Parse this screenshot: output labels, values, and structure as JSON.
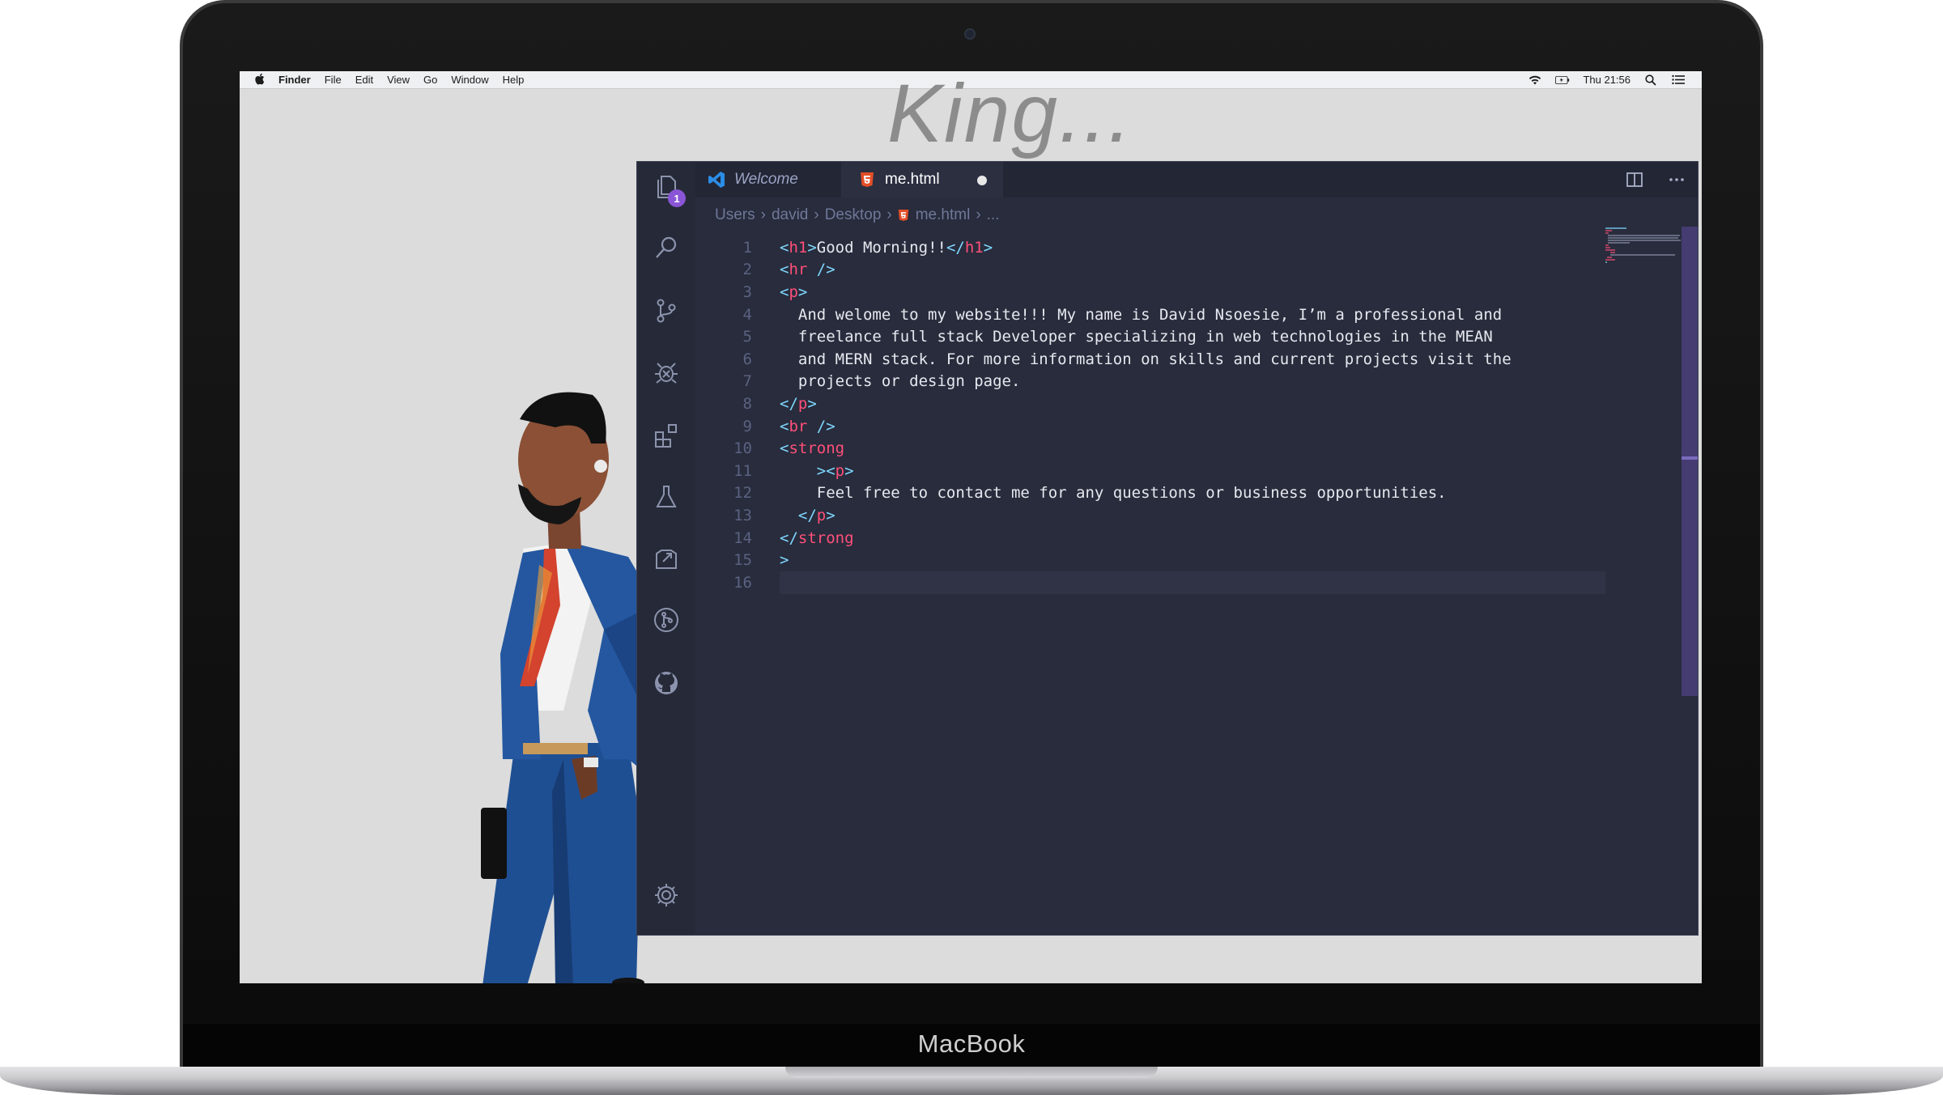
{
  "device": {
    "label": "MacBook"
  },
  "menubar": {
    "apple_icon": "apple-logo-icon",
    "items": [
      "Finder",
      "File",
      "Edit",
      "View",
      "Go",
      "Window",
      "Help"
    ],
    "clock": "Thu 21:56",
    "status_icons": [
      "wifi-icon",
      "battery-icon",
      "spotlight-search-icon",
      "notification-center-icon"
    ]
  },
  "desktop": {
    "title": "King..."
  },
  "editor": {
    "activity_bar": {
      "icons": [
        "files-icon",
        "search-icon",
        "source-control-icon",
        "debug-icon",
        "extensions-icon",
        "test-flask-icon",
        "remote-explorer-icon",
        "git-graph-icon",
        "github-icon"
      ],
      "explorer_badge": "1",
      "settings_icon": "gear-icon"
    },
    "tabs": [
      {
        "label": "Welcome",
        "icon": "vscode-logo-icon",
        "active": false
      },
      {
        "label": "me.html",
        "icon": "html5-icon",
        "active": true,
        "unsaved": true
      }
    ],
    "tab_actions": [
      "split-editor-icon",
      "more-actions-icon"
    ],
    "breadcrumbs": {
      "segments": [
        "Users",
        "david",
        "Desktop"
      ],
      "file": "me.html",
      "tail": "..."
    },
    "code_lines": [
      {
        "n": "1",
        "tokens": [
          {
            "t": "punc",
            "v": "<"
          },
          {
            "t": "tag",
            "v": "h1"
          },
          {
            "t": "punc",
            "v": ">"
          },
          {
            "t": "text",
            "v": "Good Morning!!"
          },
          {
            "t": "punc",
            "v": "</"
          },
          {
            "t": "tag",
            "v": "h1"
          },
          {
            "t": "punc",
            "v": ">"
          }
        ]
      },
      {
        "n": "2",
        "tokens": [
          {
            "t": "punc",
            "v": "<"
          },
          {
            "t": "tag",
            "v": "hr"
          },
          {
            "t": "punc",
            "v": " />"
          }
        ]
      },
      {
        "n": "3",
        "tokens": [
          {
            "t": "punc",
            "v": "<"
          },
          {
            "t": "tag",
            "v": "p"
          },
          {
            "t": "punc",
            "v": ">"
          }
        ]
      },
      {
        "n": "4",
        "tokens": [
          {
            "t": "text",
            "v": "  And welome to my website!!! My name is David Nsoesie, I’m a professional and"
          }
        ]
      },
      {
        "n": "5",
        "tokens": [
          {
            "t": "text",
            "v": "  freelance full stack Developer specializing in web technologies in the MEAN"
          }
        ]
      },
      {
        "n": "6",
        "tokens": [
          {
            "t": "text",
            "v": "  and MERN stack. For more information on skills and current projects visit the"
          }
        ]
      },
      {
        "n": "7",
        "tokens": [
          {
            "t": "text",
            "v": "  projects or design page."
          }
        ]
      },
      {
        "n": "8",
        "tokens": [
          {
            "t": "punc",
            "v": "</"
          },
          {
            "t": "tag",
            "v": "p"
          },
          {
            "t": "punc",
            "v": ">"
          }
        ]
      },
      {
        "n": "9",
        "tokens": [
          {
            "t": "punc",
            "v": "<"
          },
          {
            "t": "tag",
            "v": "br"
          },
          {
            "t": "punc",
            "v": " />"
          }
        ]
      },
      {
        "n": "10",
        "tokens": [
          {
            "t": "punc",
            "v": "<"
          },
          {
            "t": "tag",
            "v": "strong"
          }
        ]
      },
      {
        "n": "11",
        "tokens": [
          {
            "t": "punc",
            "v": "    ><"
          },
          {
            "t": "tag",
            "v": "p"
          },
          {
            "t": "punc",
            "v": ">"
          }
        ]
      },
      {
        "n": "12",
        "tokens": [
          {
            "t": "text",
            "v": "    Feel free to contact me for any questions or business opportunities."
          }
        ]
      },
      {
        "n": "13",
        "tokens": [
          {
            "t": "punc",
            "v": "  </"
          },
          {
            "t": "tag",
            "v": "p"
          },
          {
            "t": "punc",
            "v": ">"
          }
        ]
      },
      {
        "n": "14",
        "tokens": [
          {
            "t": "punc",
            "v": "</"
          },
          {
            "t": "tag",
            "v": "strong"
          }
        ]
      },
      {
        "n": "15",
        "tokens": [
          {
            "t": "punc",
            "v": ">"
          }
        ]
      },
      {
        "n": "16",
        "tokens": []
      }
    ],
    "cursor_line": 16
  },
  "colors": {
    "editor_bg": "#282c3c",
    "tag": "#ff4f7a",
    "punctuation": "#7fd8ff",
    "text": "#e6e8ef",
    "accent": "#8a55d6"
  }
}
